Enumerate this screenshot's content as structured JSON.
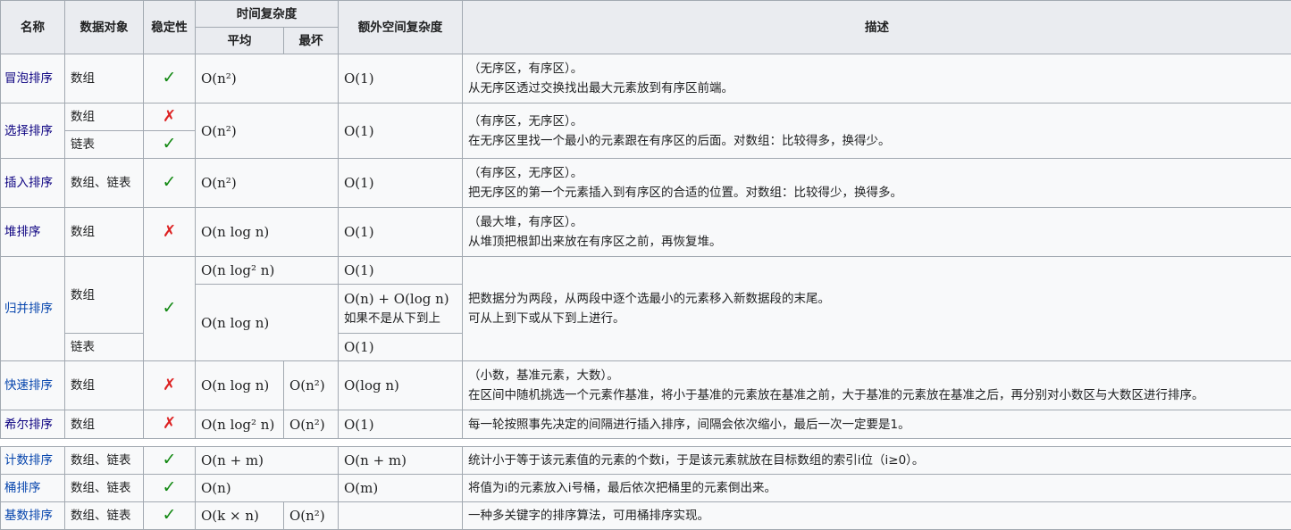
{
  "headers": {
    "name": "名称",
    "data_object": "数据对象",
    "stability": "稳定性",
    "time_complexity": "时间复杂度",
    "average": "平均",
    "worst": "最坏",
    "extra_space": "额外空间复杂度",
    "description": "描述"
  },
  "symbols": {
    "stable": "✓",
    "unstable": "✗"
  },
  "rows": {
    "bubble": {
      "name": "冒泡排序",
      "object": "数组",
      "stable": "✓",
      "avg": "O(n²)",
      "space": "O(1)",
      "desc1": "（无序区，有序区）。",
      "desc2": "从无序区透过交换找出最大元素放到有序区前端。"
    },
    "selection": {
      "name": "选择排序",
      "object1": "数组",
      "stable1": "✗",
      "object2": "链表",
      "stable2": "✓",
      "avg": "O(n²)",
      "space": "O(1)",
      "desc1": "（有序区，无序区）。",
      "desc2": "在无序区里找一个最小的元素跟在有序区的后面。对数组：比较得多，换得少。"
    },
    "insertion": {
      "name": "插入排序",
      "object": "数组、链表",
      "stable": "✓",
      "avg": "O(n²)",
      "space": "O(1)",
      "desc1": "（有序区，无序区）。",
      "desc2": "把无序区的第一个元素插入到有序区的合适的位置。对数组：比较得少，换得多。"
    },
    "heap": {
      "name": "堆排序",
      "object": "数组",
      "stable": "✗",
      "avg": "O(n log n)",
      "space": "O(1)",
      "desc1": "（最大堆，有序区）。",
      "desc2": "从堆顶把根卸出来放在有序区之前，再恢复堆。"
    },
    "merge": {
      "name": "归并排序",
      "object1": "数组",
      "object2": "链表",
      "stable": "✓",
      "avg1": "O(n log² n)",
      "space1": "O(1)",
      "avg2": "O(n log n)",
      "space2": "O(n) + O(log n)",
      "space2_note": "如果不是从下到上",
      "space3": "O(1)",
      "desc1": "把数据分为两段，从两段中逐个选最小的元素移入新数据段的末尾。",
      "desc2": "可从上到下或从下到上进行。"
    },
    "quick": {
      "name": "快速排序",
      "object": "数组",
      "stable": "✗",
      "avg": "O(n log n)",
      "worst": "O(n²)",
      "space": "O(log n)",
      "desc1": "（小数，基准元素，大数）。",
      "desc2": "在区间中随机挑选一个元素作基准，将小于基准的元素放在基准之前，大于基准的元素放在基准之后，再分别对小数区与大数区进行排序。"
    },
    "shell": {
      "name": "希尔排序",
      "object": "数组",
      "stable": "✗",
      "avg": "O(n log² n)",
      "worst": "O(n²)",
      "space": "O(1)",
      "desc1": "每一轮按照事先决定的间隔进行插入排序，间隔会依次缩小，最后一次一定要是1。"
    },
    "counting": {
      "name": "计数排序",
      "object": "数组、链表",
      "stable": "✓",
      "avg": "O(n + m)",
      "space": "O(n + m)",
      "desc1": "统计小于等于该元素值的元素的个数i，于是该元素就放在目标数组的索引i位（i≥0）。"
    },
    "bucket": {
      "name": "桶排序",
      "object": "数组、链表",
      "stable": "✓",
      "avg": "O(n)",
      "space": "O(m)",
      "desc1": "将值为i的元素放入i号桶，最后依次把桶里的元素倒出来。"
    },
    "radix": {
      "name": "基数排序",
      "object": "数组、链表",
      "stable": "✓",
      "avg": "O(k × n)",
      "worst": "O(n²)",
      "space": "",
      "desc1": "一种多关键字的排序算法，可用桶排序实现。"
    }
  }
}
